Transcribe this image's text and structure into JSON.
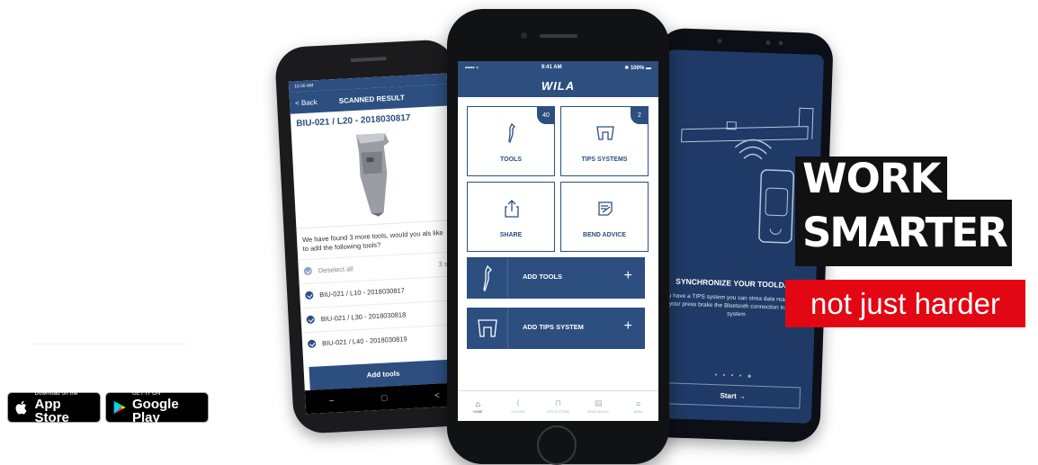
{
  "badges": {
    "appstore_small": "Download on the",
    "appstore_big": "App Store",
    "google_small": "GET IT ON",
    "google_big": "Google Play"
  },
  "left_phone": {
    "status_time": "10:30 AM",
    "back": "< Back",
    "title": "SCANNED RESULT",
    "code": "BIU-021 / L20 - 2018030817",
    "question": "We have found 3 more tools, would you als like to add the following tools?",
    "deselect": "Deselect all",
    "count": "3 se",
    "items": [
      "BIU-021 / L10 - 2018030817",
      "BIU-021 / L30 - 2018030818",
      "BIU-021 / L40 - 2018030819"
    ],
    "add_button": "Add tools",
    "nav": [
      "−",
      "□",
      "<"
    ]
  },
  "center_phone": {
    "carrier": "••••• ▿",
    "time": "9:41 AM",
    "battery": "✱ 100% ▬",
    "logo": "WILA",
    "tiles": [
      {
        "label": "TOOLS",
        "badge": "40"
      },
      {
        "label": "TIPS SYSTEMS",
        "badge": "2"
      },
      {
        "label": "SHARE"
      },
      {
        "label": "BEND ADVICE"
      }
    ],
    "bars": [
      {
        "label": "ADD TOOLS",
        "plus": "+"
      },
      {
        "label": "ADD TIPS SYSTEM",
        "plus": "+"
      }
    ],
    "tabs": [
      "HOME",
      "TOOLING",
      "TIPS SYSTEMS",
      "BEND ADVICE",
      "MENU"
    ]
  },
  "right_phone": {
    "title": "SYNCHRONIZE YOUR TOOLDATA",
    "text": "u have a TIPS system you can strea data real time to your press brake the Bluetooth connection in the cla system",
    "dots": "• • • • ●",
    "start": "Start →"
  },
  "slogan": {
    "line1": "WORK",
    "line2": "SMARTER",
    "line3": "not just harder"
  },
  "colors": {
    "brand_blue": "#2c4f80",
    "slogan_red": "#e30613",
    "slogan_black": "#111111"
  }
}
